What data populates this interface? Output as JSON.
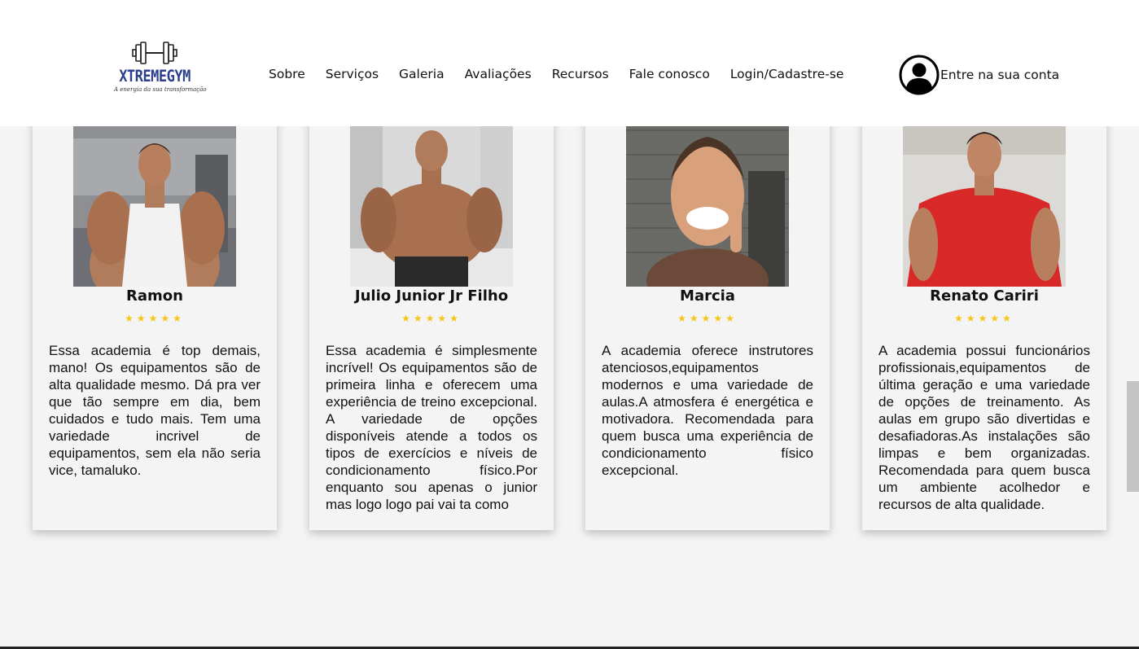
{
  "brand": {
    "name": "XTREMEGYM",
    "tagline": "A energia da sua transformação",
    "logo_color": "#2c3f8f"
  },
  "nav": {
    "items": [
      "Sobre",
      "Serviços",
      "Galeria",
      "Avaliações",
      "Recursos",
      "Fale conosco",
      "Login/Cadastre-se"
    ]
  },
  "account": {
    "label": "Entre na sua conta",
    "icon": "user-circle-icon"
  },
  "reviews": [
    {
      "name": "Ramon",
      "rating": 5,
      "stars": "★★★★★",
      "text": "Essa academia é top demais, mano! Os equipamentos são de alta qualidade mesmo. Dá pra ver que tão sempre em dia, bem cuidados e tudo mais. Tem uma variedade incrivel de equipamentos, sem ela não seria vice, tamaluko."
    },
    {
      "name": "Julio Junior Jr Filho",
      "rating": 5,
      "stars": "★★★★★",
      "text": "Essa academia é simplesmente incrível! Os equipamentos são de primeira linha e oferecem uma experiência de treino excepcional. A variedade de opções disponíveis atende a todos os tipos de exercícios e níveis de condicionamento físico.Por enquanto sou apenas o junior mas logo logo pai vai ta como"
    },
    {
      "name": "Marcia",
      "rating": 5,
      "stars": "★★★★★",
      "text": "A academia oferece instrutores atenciosos,equipamentos modernos e uma variedade de aulas.A atmosfera é energética e motivadora. Recomendada para quem busca uma experiência de condicionamento físico excepcional."
    },
    {
      "name": "Renato Cariri",
      "rating": 5,
      "stars": "★★★★★",
      "text": "A academia possui funcionários profissionais,equipamentos de última geração e uma variedade de opções de treinamento. As aulas em grupo são divertidas e desafiadoras.As instalações são limpas e bem organizadas. Recomendada para quem busca um ambiente acolhedor e recursos de alta qualidade."
    }
  ],
  "colors": {
    "star": "#f5c518",
    "page_background": "#f4f4f4",
    "header_background": "#ffffff"
  }
}
